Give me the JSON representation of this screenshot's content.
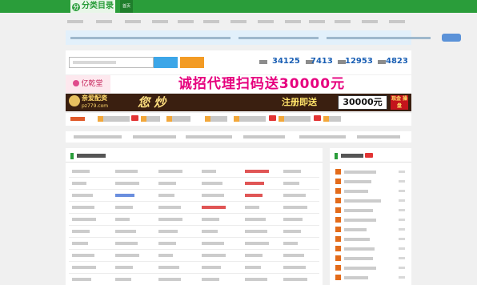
{
  "header": {
    "logo_text": "分类目录",
    "logo_mark": "分",
    "nav": [
      "首页",
      "",
      "",
      "",
      "",
      "",
      "",
      "",
      "",
      "",
      "",
      "",
      ""
    ]
  },
  "stats": [
    {
      "label": "",
      "value": "34125"
    },
    {
      "label": "",
      "value": "7413"
    },
    {
      "label": "",
      "value": "12953"
    },
    {
      "label": "",
      "value": "4823"
    }
  ],
  "banner1": {
    "brand": "亿乾堂",
    "headline": "诚招代理扫码送30000元"
  },
  "banner2": {
    "brand": "亲爱配资",
    "site": "pz779.com",
    "slogan": "您 炒",
    "cta": "注册即送",
    "amount": "30000元",
    "tag": "现金 操盘"
  },
  "colors": {
    "brand_green": "#2a9d3a",
    "stat_blue": "#1a5fb4",
    "banner_pink": "#e6007e",
    "banner_dark": "#3a1f10"
  }
}
